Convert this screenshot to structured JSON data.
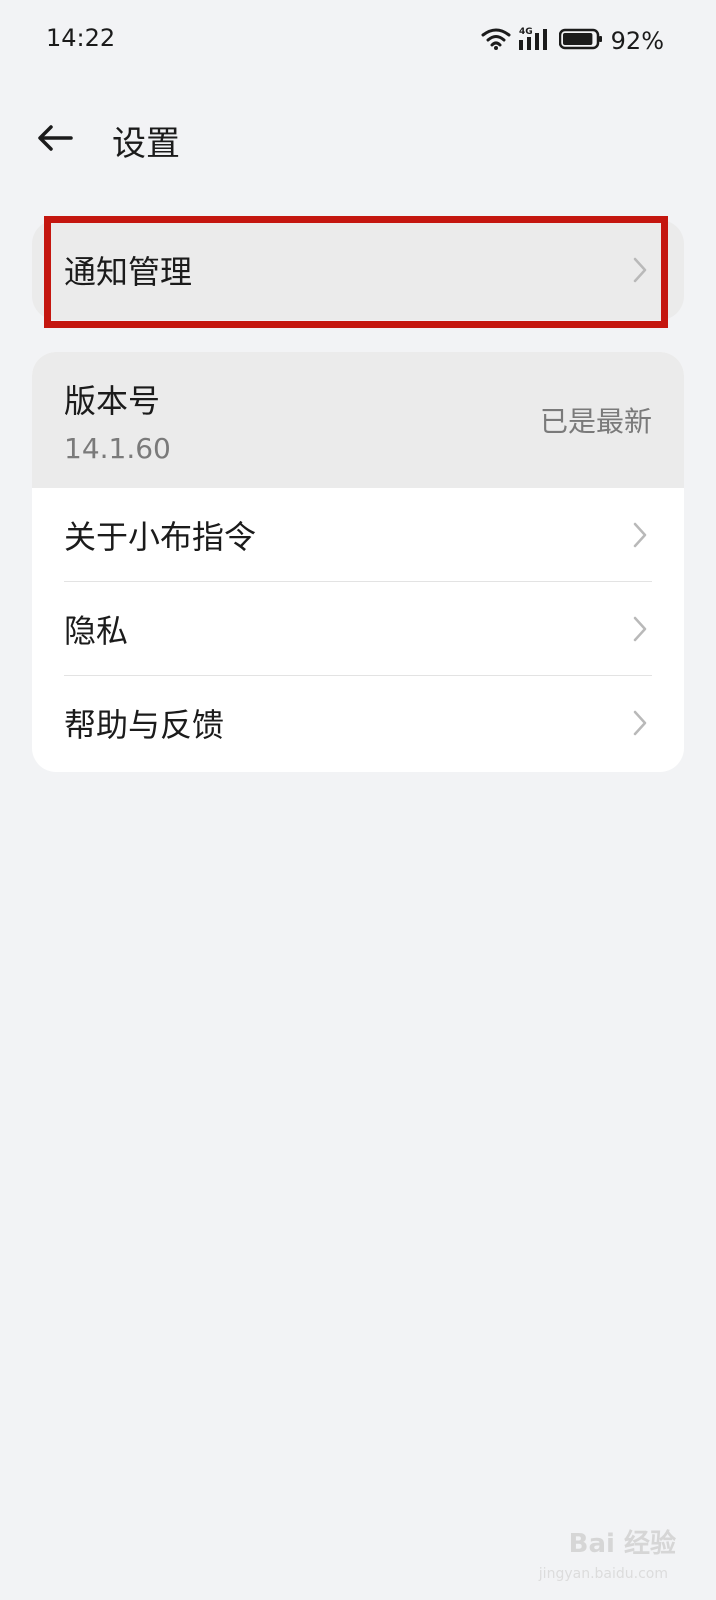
{
  "status_bar": {
    "time": "14:22",
    "network": "4G",
    "battery": "92%",
    "battery_level": 0.92,
    "icons": [
      "wifi-icon",
      "signal-icon",
      "battery-icon"
    ]
  },
  "header": {
    "title": "设置",
    "back_icon": "arrow-left-icon"
  },
  "notify_card": {
    "label": "通知管理",
    "chevron": "chevron-right-icon"
  },
  "main_card": {
    "version": {
      "label": "版本号",
      "number": "14.1.60",
      "status": "已是最新"
    },
    "items": [
      {
        "label": "关于小布指令"
      },
      {
        "label": "隐私"
      },
      {
        "label": "帮助与反馈"
      }
    ]
  },
  "highlight_color": "#c4160f",
  "watermark": {
    "brand": "Bai 经验",
    "sub": "jingyan.baidu.com"
  }
}
